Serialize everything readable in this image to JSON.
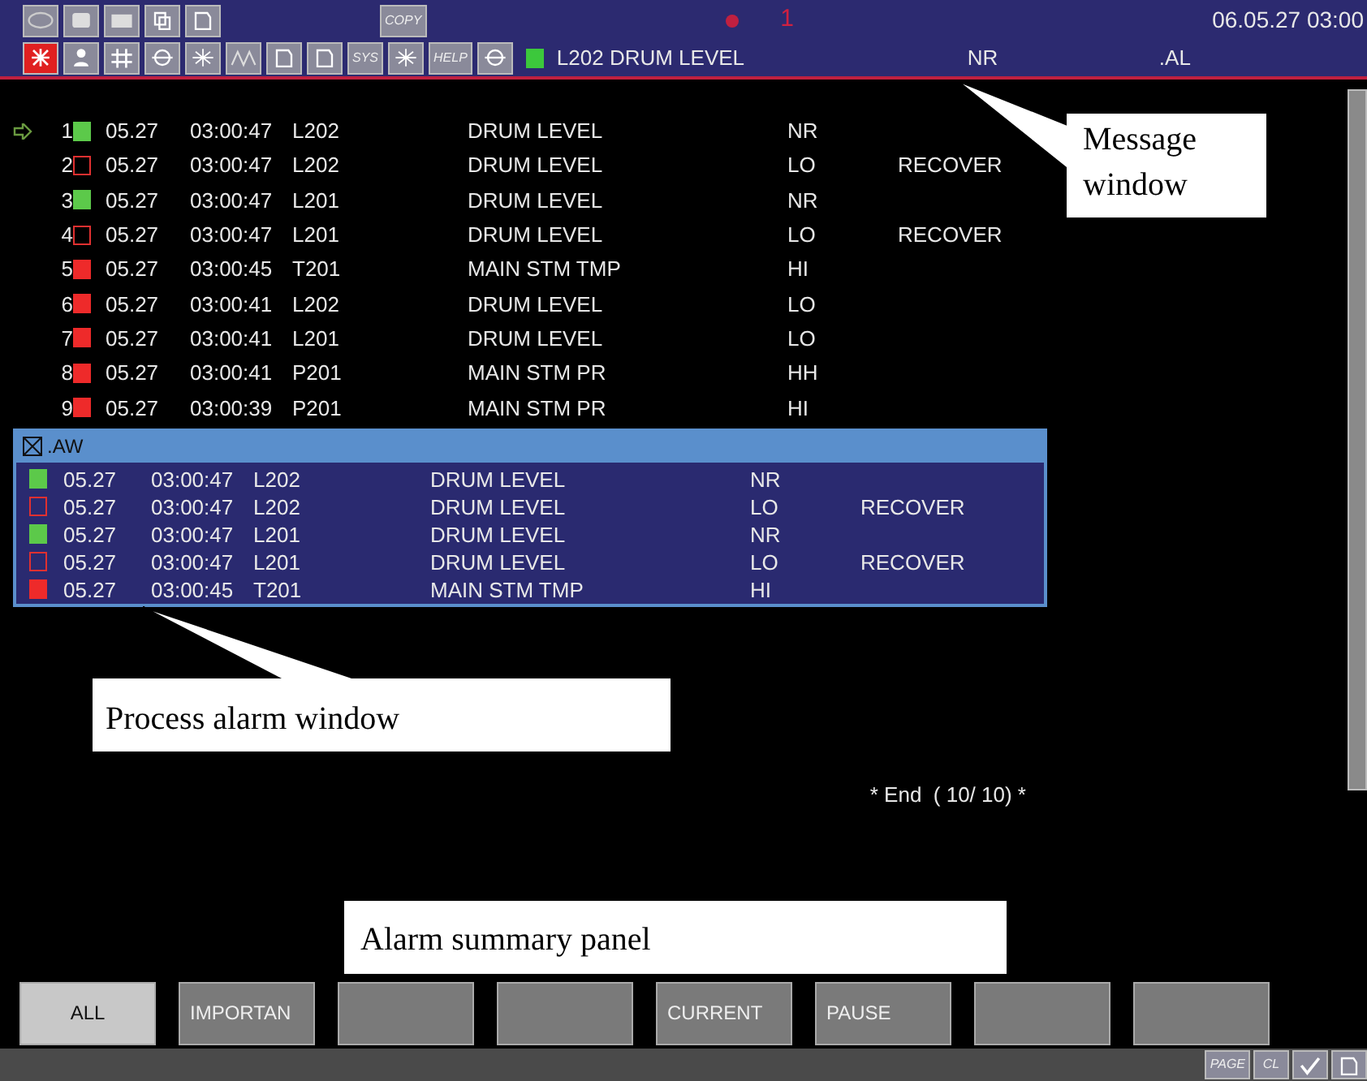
{
  "header": {
    "tools_top": [
      {
        "kind": "operator"
      },
      {
        "kind": "window"
      },
      {
        "kind": "printer"
      },
      {
        "kind": "copy-doc"
      },
      {
        "kind": "doc"
      },
      {
        "kind": "text",
        "label": "COPY"
      }
    ],
    "alarm_indicator": "1",
    "datetime": "06.05.27 03:00",
    "tools_bottom": [
      {
        "kind": "alarm",
        "selected": true
      },
      {
        "kind": "person",
        "selected": false
      },
      {
        "kind": "hash",
        "selected": false
      },
      {
        "kind": "target",
        "selected": false
      },
      {
        "kind": "spark",
        "selected": false
      },
      {
        "kind": "wave",
        "selected": false
      },
      {
        "kind": "doc",
        "selected": false
      },
      {
        "kind": "doc",
        "selected": false
      },
      {
        "kind": "text",
        "label": "SYS",
        "selected": false
      },
      {
        "kind": "spark",
        "selected": false
      },
      {
        "kind": "text",
        "label": "HELP",
        "selected": false
      },
      {
        "kind": "target",
        "selected": false
      }
    ],
    "message": {
      "color": "#3cc83c",
      "text": "L202 DRUM LEVEL",
      "status": "NR",
      "window": ".AL"
    }
  },
  "alarm_list": {
    "rows": [
      {
        "number": "1",
        "current": true,
        "color": "#5cc94a",
        "filled": true,
        "date": "05.27",
        "time": "03:00:47",
        "tag": "L202",
        "description": "DRUM LEVEL",
        "status": "NR"
      },
      {
        "number": "2",
        "current": false,
        "color": "#e03030",
        "filled": false,
        "date": "05.27",
        "time": "03:00:47",
        "tag": "L202",
        "description": "DRUM LEVEL",
        "status": "LO",
        "note": "RECOVER"
      },
      {
        "number": "3",
        "current": false,
        "color": "#5cc94a",
        "filled": true,
        "date": "05.27",
        "time": "03:00:47",
        "tag": "L201",
        "description": "DRUM LEVEL",
        "status": "NR"
      },
      {
        "number": "4",
        "current": false,
        "color": "#e03030",
        "filled": false,
        "date": "05.27",
        "time": "03:00:47",
        "tag": "L201",
        "description": "DRUM LEVEL",
        "status": "LO",
        "note": "RECOVER"
      },
      {
        "number": "5",
        "current": false,
        "color": "#ee2a2a",
        "filled": true,
        "date": "05.27",
        "time": "03:00:45",
        "tag": "T201",
        "description": "MAIN STM TMP",
        "status": "HI"
      },
      {
        "number": "6",
        "current": false,
        "color": "#ee2a2a",
        "filled": true,
        "date": "05.27",
        "time": "03:00:41",
        "tag": "L202",
        "description": "DRUM LEVEL",
        "status": "LO"
      },
      {
        "number": "7",
        "current": false,
        "color": "#ee2a2a",
        "filled": true,
        "date": "05.27",
        "time": "03:00:41",
        "tag": "L201",
        "description": "DRUM LEVEL",
        "status": "LO"
      },
      {
        "number": "8",
        "current": false,
        "color": "#ee2a2a",
        "filled": true,
        "date": "05.27",
        "time": "03:00:41",
        "tag": "P201",
        "description": "MAIN STM PR",
        "status": "HH"
      },
      {
        "number": "9",
        "current": false,
        "color": "#ee2a2a",
        "filled": true,
        "date": "05.27",
        "time": "03:00:39",
        "tag": "P201",
        "description": "MAIN STM PR",
        "status": "HI"
      }
    ],
    "end_label": "* End  ( 10/ 10) *"
  },
  "process_alarm_window": {
    "title": ".AW",
    "rows": [
      {
        "color": "#5cc94a",
        "filled": true,
        "date": "05.27",
        "time": "03:00:47",
        "tag": "L202",
        "description": "DRUM LEVEL",
        "status": "NR"
      },
      {
        "color": "#e03030",
        "filled": false,
        "date": "05.27",
        "time": "03:00:47",
        "tag": "L202",
        "description": "DRUM LEVEL",
        "status": "LO",
        "note": "RECOVER"
      },
      {
        "color": "#5cc94a",
        "filled": true,
        "date": "05.27",
        "time": "03:00:47",
        "tag": "L201",
        "description": "DRUM LEVEL",
        "status": "NR"
      },
      {
        "color": "#e03030",
        "filled": false,
        "date": "05.27",
        "time": "03:00:47",
        "tag": "L201",
        "description": "DRUM LEVEL",
        "status": "LO",
        "note": "RECOVER"
      },
      {
        "color": "#ee2a2a",
        "filled": true,
        "date": "05.27",
        "time": "03:00:45",
        "tag": "T201",
        "description": "MAIN STM TMP",
        "status": "HI"
      }
    ]
  },
  "function_keys": [
    {
      "label": "ALL",
      "selected": true
    },
    {
      "label": "IMPORTAN",
      "selected": false
    },
    {
      "selected": false
    },
    {
      "selected": false
    },
    {
      "label": "CURRENT",
      "selected": false
    },
    {
      "label": "PAUSE",
      "selected": false
    },
    {
      "selected": false
    },
    {
      "selected": false
    }
  ],
  "status_bar": {
    "tools": [
      {
        "kind": "text",
        "label": "PAGE"
      },
      {
        "kind": "text",
        "label": "CL"
      },
      {
        "kind": "check"
      },
      {
        "kind": "doc"
      }
    ]
  },
  "callouts": [
    {
      "text": "Message window"
    },
    {
      "text": "Process alarm window"
    },
    {
      "text": "Alarm summary panel"
    }
  ]
}
